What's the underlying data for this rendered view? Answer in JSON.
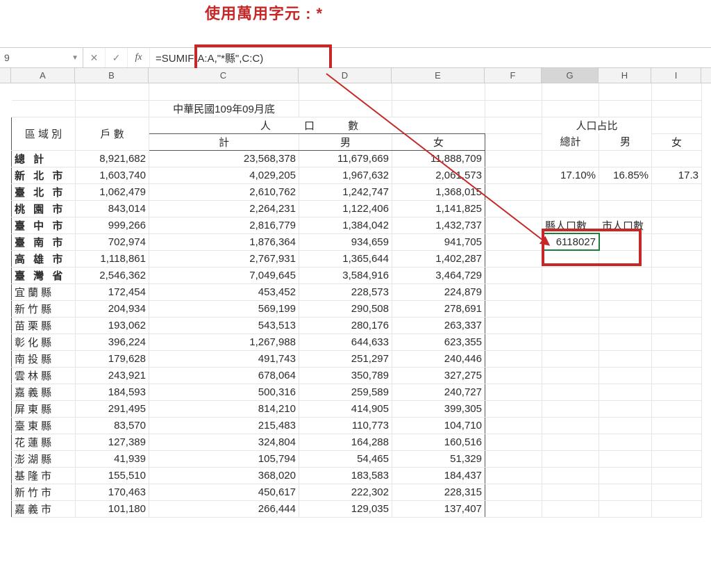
{
  "annotation": "使用萬用字元 : *",
  "namebox": "9",
  "formula": "=SUMIF(A:A,\"*縣\",C:C)",
  "columns": [
    "A",
    "B",
    "C",
    "D",
    "E",
    "F",
    "G",
    "H",
    "I"
  ],
  "title_row": {
    "c": "中華民國109年09月底"
  },
  "header1": {
    "a": "區 域 別",
    "b": "戶  數",
    "cde": "人    口    數"
  },
  "header2": {
    "c": "計",
    "d": "男",
    "e": "女"
  },
  "right_header1": {
    "g": "人口占比"
  },
  "right_header2": {
    "g": "總計",
    "h": "男",
    "i": "女"
  },
  "right_pct": {
    "g": "17.10%",
    "h": "16.85%",
    "i": "17.3"
  },
  "county_label": "縣人口數",
  "city_label": "市人口數",
  "county_sum": "6118027",
  "rows": [
    {
      "a": "總  計",
      "b": "8,921,682",
      "c": "23,568,378",
      "d": "11,679,669",
      "e": "11,888,709",
      "bold": true
    },
    {
      "a": "新 北 市",
      "b": "1,603,740",
      "c": "4,029,205",
      "d": "1,967,632",
      "e": "2,061,573",
      "bold": true
    },
    {
      "a": "臺 北 市",
      "b": "1,062,479",
      "c": "2,610,762",
      "d": "1,242,747",
      "e": "1,368,015",
      "bold": true
    },
    {
      "a": "桃 園 市",
      "b": "843,014",
      "c": "2,264,231",
      "d": "1,122,406",
      "e": "1,141,825",
      "bold": true
    },
    {
      "a": "臺 中 市",
      "b": "999,266",
      "c": "2,816,779",
      "d": "1,384,042",
      "e": "1,432,737",
      "bold": true
    },
    {
      "a": "臺 南 市",
      "b": "702,974",
      "c": "1,876,364",
      "d": "934,659",
      "e": "941,705",
      "bold": true
    },
    {
      "a": "高 雄 市",
      "b": "1,118,861",
      "c": "2,767,931",
      "d": "1,365,644",
      "e": "1,402,287",
      "bold": true
    },
    {
      "a": "臺 灣 省",
      "b": "2,546,362",
      "c": "7,049,645",
      "d": "3,584,916",
      "e": "3,464,729",
      "bold": true
    },
    {
      "a": "宜蘭縣",
      "b": "172,454",
      "c": "453,452",
      "d": "228,573",
      "e": "224,879"
    },
    {
      "a": "新竹縣",
      "b": "204,934",
      "c": "569,199",
      "d": "290,508",
      "e": "278,691"
    },
    {
      "a": "苗栗縣",
      "b": "193,062",
      "c": "543,513",
      "d": "280,176",
      "e": "263,337"
    },
    {
      "a": "彰化縣",
      "b": "396,224",
      "c": "1,267,988",
      "d": "644,633",
      "e": "623,355"
    },
    {
      "a": "南投縣",
      "b": "179,628",
      "c": "491,743",
      "d": "251,297",
      "e": "240,446"
    },
    {
      "a": "雲林縣",
      "b": "243,921",
      "c": "678,064",
      "d": "350,789",
      "e": "327,275"
    },
    {
      "a": "嘉義縣",
      "b": "184,593",
      "c": "500,316",
      "d": "259,589",
      "e": "240,727"
    },
    {
      "a": "屏東縣",
      "b": "291,495",
      "c": "814,210",
      "d": "414,905",
      "e": "399,305"
    },
    {
      "a": "臺東縣",
      "b": "83,570",
      "c": "215,483",
      "d": "110,773",
      "e": "104,710"
    },
    {
      "a": "花蓮縣",
      "b": "127,389",
      "c": "324,804",
      "d": "164,288",
      "e": "160,516"
    },
    {
      "a": "澎湖縣",
      "b": "41,939",
      "c": "105,794",
      "d": "54,465",
      "e": "51,329"
    },
    {
      "a": "基隆市",
      "b": "155,510",
      "c": "368,020",
      "d": "183,583",
      "e": "184,437"
    },
    {
      "a": "新竹市",
      "b": "170,463",
      "c": "450,617",
      "d": "222,302",
      "e": "228,315"
    },
    {
      "a": "嘉義市",
      "b": "101,180",
      "c": "266,444",
      "d": "129,035",
      "e": "137,407"
    }
  ]
}
